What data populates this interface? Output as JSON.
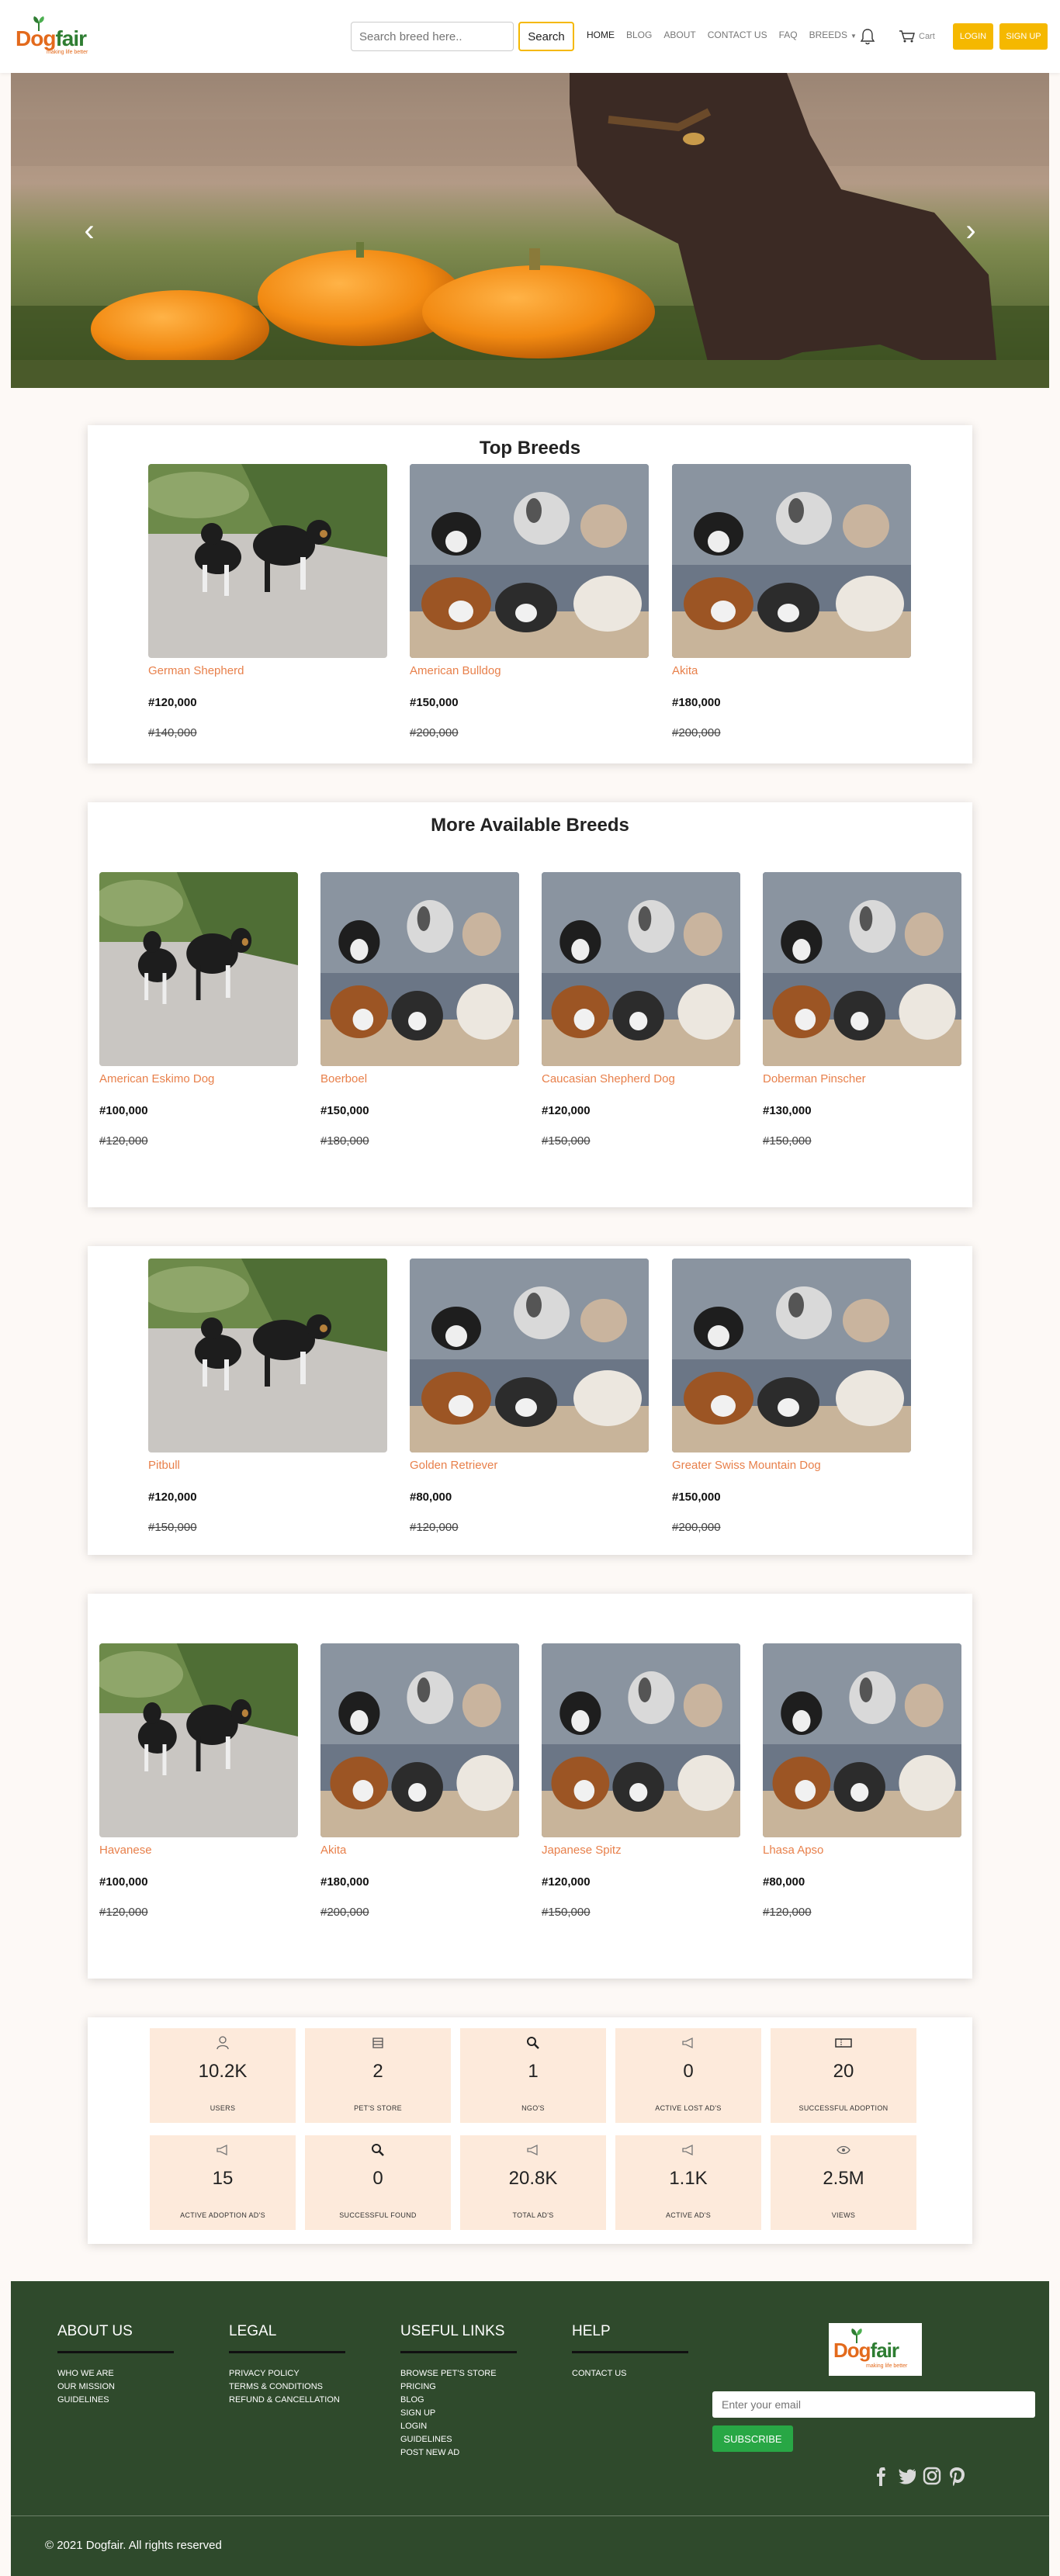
{
  "brand": {
    "name_a": "Dog",
    "name_b": "fair",
    "tagline": "making life better"
  },
  "nav": {
    "search_placeholder": "Search breed here..",
    "search_button": "Search",
    "links": [
      "HOME",
      "BLOG",
      "ABOUT",
      "CONTACT US",
      "FAQ",
      "BREEDS"
    ],
    "cart": "Cart",
    "login": "LOGIN",
    "signup": "SIGN UP"
  },
  "hero": {
    "prev": "‹",
    "next": "›"
  },
  "top_breeds": {
    "title": "Top Breeds",
    "items": [
      {
        "name": "German Shepherd",
        "price": "#120,000",
        "old_price": "#140,000",
        "image": "puppies-walking"
      },
      {
        "name": "American Bulldog",
        "price": "#150,000",
        "old_price": "#200,000",
        "image": "puppies-sitting"
      },
      {
        "name": "Akita",
        "price": "#180,000",
        "old_price": "#200,000",
        "image": "puppies-sitting"
      }
    ]
  },
  "more_breeds": {
    "title": "More Available Breeds",
    "items": [
      {
        "name": "American Eskimo Dog",
        "price": "#100,000",
        "old_price": "#120,000",
        "image": "puppies-walking"
      },
      {
        "name": "Boerboel",
        "price": "#150,000",
        "old_price": "#180,000",
        "image": "puppies-sitting"
      },
      {
        "name": "Caucasian Shepherd Dog",
        "price": "#120,000",
        "old_price": "#150,000",
        "image": "puppies-sitting"
      },
      {
        "name": "Doberman Pinscher",
        "price": "#130,000",
        "old_price": "#150,000",
        "image": "puppies-sitting"
      }
    ]
  },
  "breeds_row3": {
    "items": [
      {
        "name": "Pitbull",
        "price": "#120,000",
        "old_price": "#150,000",
        "image": "puppies-walking"
      },
      {
        "name": "Golden Retriever",
        "price": "#80,000",
        "old_price": "#120,000",
        "image": "puppies-sitting"
      },
      {
        "name": "Greater Swiss Mountain Dog",
        "price": "#150,000",
        "old_price": "#200,000",
        "image": "puppies-sitting"
      }
    ]
  },
  "breeds_row4": {
    "items": [
      {
        "name": "Havanese",
        "price": "#100,000",
        "old_price": "#120,000",
        "image": "puppies-walking"
      },
      {
        "name": "Akita",
        "price": "#180,000",
        "old_price": "#200,000",
        "image": "puppies-sitting"
      },
      {
        "name": "Japanese Spitz",
        "price": "#120,000",
        "old_price": "#150,000",
        "image": "puppies-sitting"
      },
      {
        "name": "Lhasa Apso",
        "price": "#80,000",
        "old_price": "#120,000",
        "image": "puppies-sitting"
      }
    ]
  },
  "stats": [
    {
      "value": "10.2K",
      "label": "USERS",
      "icon": "user-icon"
    },
    {
      "value": "2",
      "label": "PET'S STORE",
      "icon": "store-icon"
    },
    {
      "value": "1",
      "label": "NGO'S",
      "icon": "magnifier-icon"
    },
    {
      "value": "0",
      "label": "ACTIVE LOST AD'S",
      "icon": "megaphone-icon"
    },
    {
      "value": "20",
      "label": "SUCCESSFUL ADOPTION",
      "icon": "ticket-icon"
    },
    {
      "value": "15",
      "label": "ACTIVE ADOPTION AD'S",
      "icon": "megaphone-icon"
    },
    {
      "value": "0",
      "label": "SUCCESSFUL FOUND",
      "icon": "magnifier-icon"
    },
    {
      "value": "20.8K",
      "label": "TOTAL AD'S",
      "icon": "megaphone-icon"
    },
    {
      "value": "1.1K",
      "label": "ACTIVE AD'S",
      "icon": "megaphone-icon"
    },
    {
      "value": "2.5M",
      "label": "VIEWS",
      "icon": "eye-icon"
    }
  ],
  "footer": {
    "about": {
      "title": "ABOUT US",
      "links": [
        "WHO WE ARE",
        "OUR MISSION",
        "GUIDELINES"
      ]
    },
    "legal": {
      "title": "LEGAL",
      "links": [
        "PRIVACY POLICY",
        "TERMS & CONDITIONS",
        "REFUND & CANCELLATION"
      ]
    },
    "useful": {
      "title": "USEFUL LINKS",
      "links": [
        "BROWSE PET'S STORE",
        "PRICING",
        "BLOG",
        "SIGN UP",
        "LOGIN",
        "GUIDELINES",
        "POST NEW AD"
      ]
    },
    "help": {
      "title": "HELP",
      "links": [
        "CONTACT US"
      ]
    },
    "email_placeholder": "Enter your email",
    "subscribe": "SUBSCRIBE",
    "socials": [
      "facebook-icon",
      "twitter-icon",
      "instagram-icon",
      "pinterest-icon"
    ],
    "copyright": "© 2021 Dogfair. All rights reserved"
  },
  "colors": {
    "accent": "#f5b800",
    "breed_name": "#e8804b",
    "footer_bg": "#2f4a2c",
    "stat_bg": "#fdeadb",
    "subscribe": "#28a745"
  }
}
